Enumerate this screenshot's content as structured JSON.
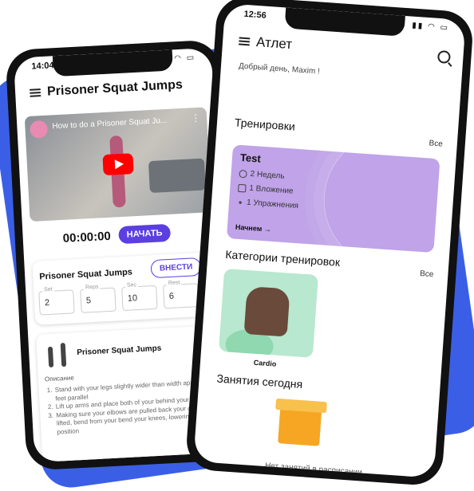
{
  "left_phone": {
    "time": "14:04",
    "title": "Prisoner Squat Jumps",
    "video_title": "How to do a Prisoner Squat Ju...",
    "timer": "00:00:00",
    "start_label": "НАЧАТЬ",
    "exercise_name": "Prisoner Squat Jumps",
    "insert_label": "ВНЕСТИ",
    "fields": [
      {
        "label": "Set",
        "value": "2"
      },
      {
        "label": "Reps",
        "value": "5"
      },
      {
        "label": "Sec",
        "value": "10"
      },
      {
        "label": "Rest",
        "value": "6"
      }
    ],
    "detail_name": "Prisoner Squat Jumps",
    "description_label": "Описание",
    "steps": [
      "Stand with your legs slightly wider than width apart, your feet parallel",
      "Lift up arms and place both of your behind your head",
      "Making sure your elbows are pulled back your chest is lifted, bend from your bend your knees, lowering down to position"
    ]
  },
  "right_phone": {
    "time": "12:56",
    "title": "Атлет",
    "greeting": "Добрый день, Maxim !",
    "workouts_title": "Тренировки",
    "all_label": "Все",
    "workout_card": {
      "title": "Test",
      "weeks": "2 Недель",
      "attachments": "1 Вложение",
      "exercises": "1 Упражнения",
      "start": "Начнем →"
    },
    "categories_title": "Категории тренировок",
    "categories_all": "Все",
    "category_label": "Cardio",
    "today_title": "Занятия сегодня",
    "empty_text": "Нет занятий в расписании"
  },
  "colors": {
    "accent": "#5b3fe0",
    "card": "#c0a3e8",
    "blob": "#3a5fe6"
  }
}
